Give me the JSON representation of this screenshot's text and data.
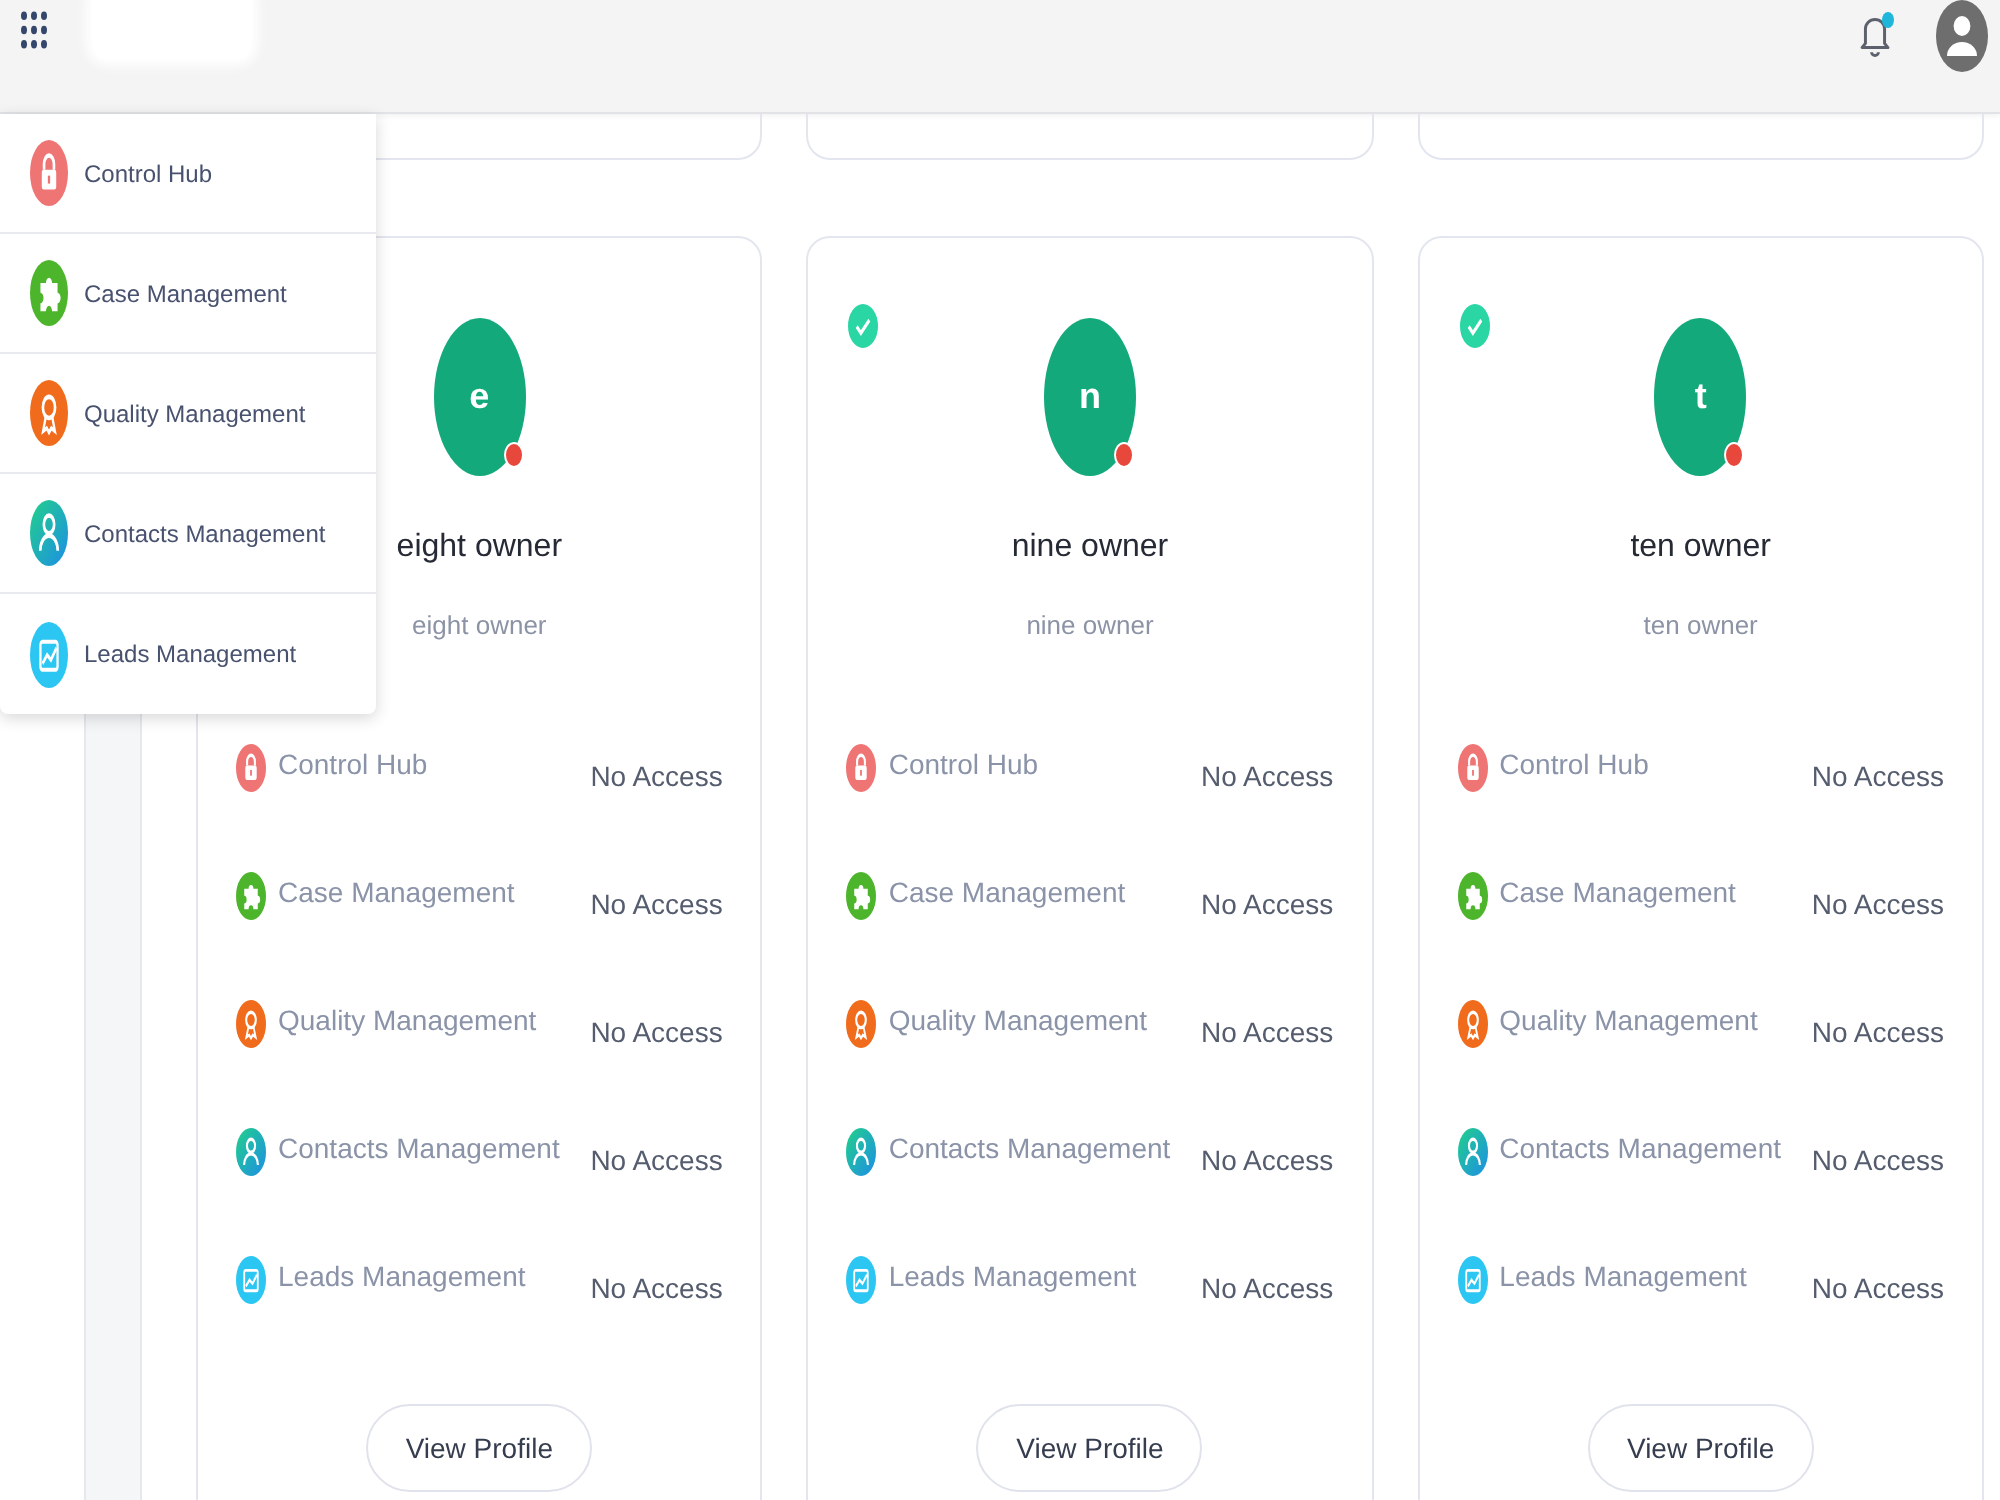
{
  "header": {
    "notifications": {
      "unread": true
    }
  },
  "app_menu": {
    "open": true,
    "items": [
      {
        "label": "Control Hub",
        "kind": "lock"
      },
      {
        "label": "Case Management",
        "kind": "puzzle"
      },
      {
        "label": "Quality Management",
        "kind": "medal"
      },
      {
        "label": "Contacts Management",
        "kind": "contact"
      },
      {
        "label": "Leads Management",
        "kind": "chart"
      }
    ]
  },
  "cards": [
    {
      "initial": "e",
      "name": "eight owner",
      "subtitle": "eight owner",
      "online": false,
      "modules": [
        {
          "label": "Control Hub",
          "kind": "lock",
          "access": "No Access"
        },
        {
          "label": "Case Management",
          "kind": "puzzle",
          "access": "No Access"
        },
        {
          "label": "Quality Management",
          "kind": "medal",
          "access": "No Access"
        },
        {
          "label": "Contacts Management",
          "kind": "contact",
          "access": "No Access"
        },
        {
          "label": "Leads Management",
          "kind": "chart",
          "access": "No Access"
        }
      ],
      "button": "View Profile"
    },
    {
      "initial": "n",
      "name": "nine owner",
      "subtitle": "nine owner",
      "selected": true,
      "online": false,
      "modules": [
        {
          "label": "Control Hub",
          "kind": "lock",
          "access": "No Access"
        },
        {
          "label": "Case Management",
          "kind": "puzzle",
          "access": "No Access"
        },
        {
          "label": "Quality Management",
          "kind": "medal",
          "access": "No Access"
        },
        {
          "label": "Contacts Management",
          "kind": "contact",
          "access": "No Access"
        },
        {
          "label": "Leads Management",
          "kind": "chart",
          "access": "No Access"
        }
      ],
      "button": "View Profile"
    },
    {
      "initial": "t",
      "name": "ten owner",
      "subtitle": "ten owner",
      "selected": true,
      "online": false,
      "modules": [
        {
          "label": "Control Hub",
          "kind": "lock",
          "access": "No Access"
        },
        {
          "label": "Case Management",
          "kind": "puzzle",
          "access": "No Access"
        },
        {
          "label": "Quality Management",
          "kind": "medal",
          "access": "No Access"
        },
        {
          "label": "Contacts Management",
          "kind": "contact",
          "access": "No Access"
        },
        {
          "label": "Leads Management",
          "kind": "chart",
          "access": "No Access"
        }
      ],
      "button": "View Profile"
    }
  ]
}
